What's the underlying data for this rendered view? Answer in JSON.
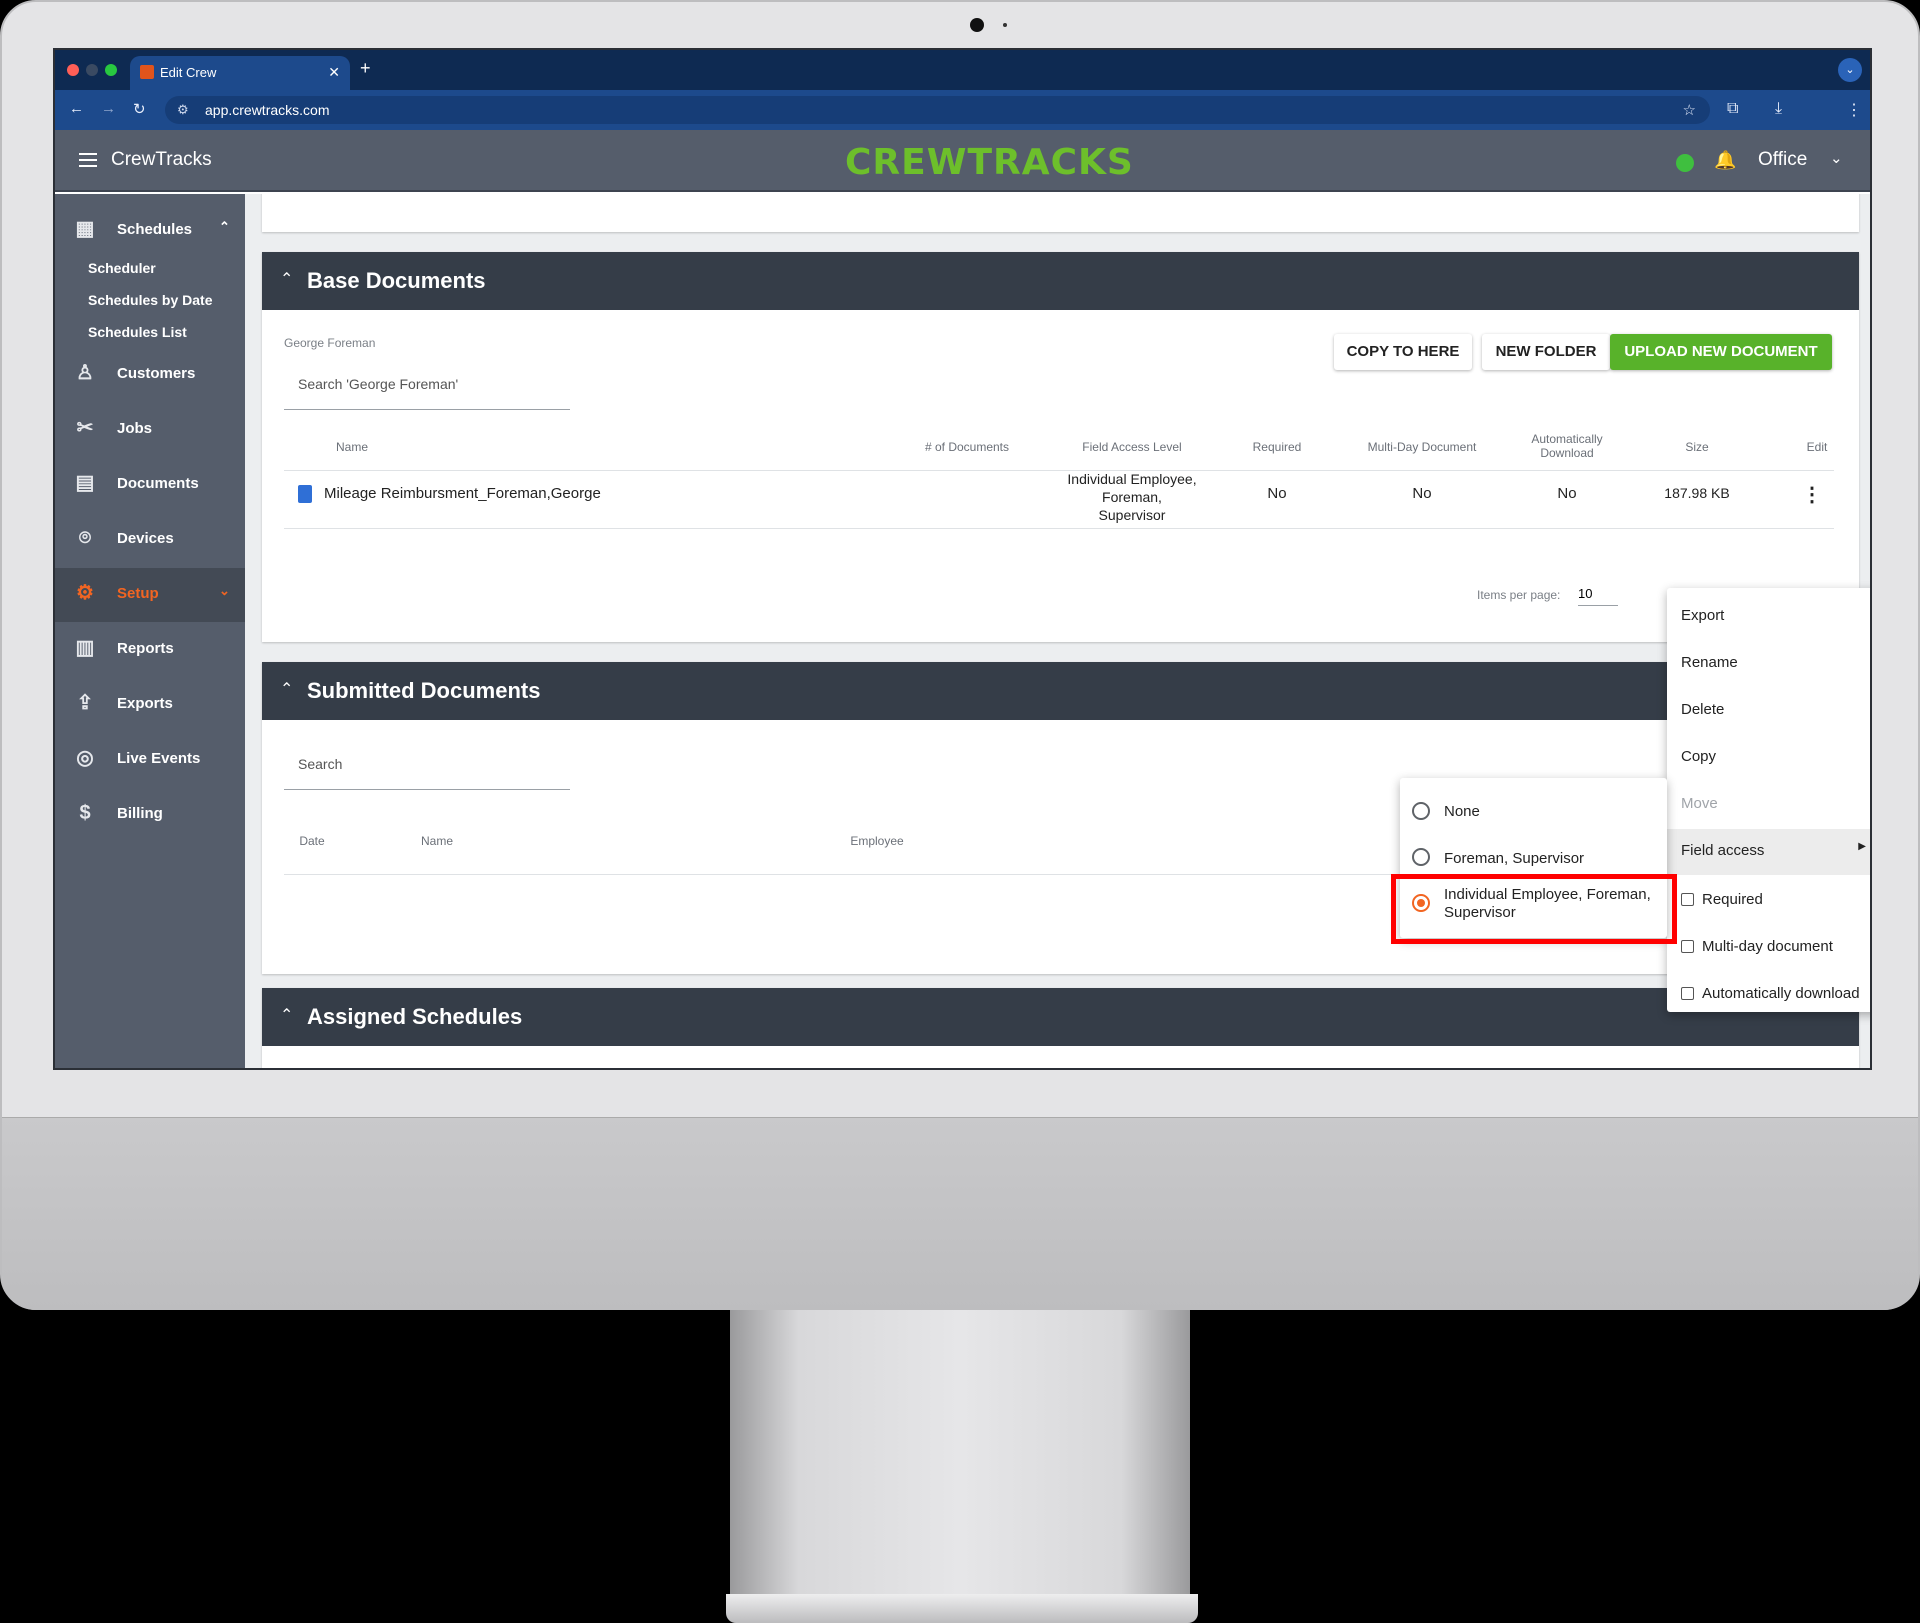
{
  "browser": {
    "tab_title": "Edit Crew",
    "url": "app.crewtracks.com"
  },
  "header": {
    "app_name": "CrewTracks",
    "logo_text": "CREWTRACKS",
    "user_label": "Office",
    "status_color": "#3fbf3f"
  },
  "sidebar": {
    "items": [
      {
        "label": "Schedules",
        "icon": "calendar-icon"
      },
      {
        "label": "Customers",
        "icon": "customer-icon"
      },
      {
        "label": "Jobs",
        "icon": "tools-icon"
      },
      {
        "label": "Documents",
        "icon": "documents-icon"
      },
      {
        "label": "Devices",
        "icon": "location-pin-icon"
      },
      {
        "label": "Setup",
        "icon": "gear-icon"
      },
      {
        "label": "Reports",
        "icon": "bar-chart-icon"
      },
      {
        "label": "Exports",
        "icon": "upload-icon"
      },
      {
        "label": "Live Events",
        "icon": "radar-icon"
      },
      {
        "label": "Billing",
        "icon": "billing-icon"
      }
    ],
    "sub_items": [
      "Scheduler",
      "Schedules by Date",
      "Schedules List"
    ],
    "accent_color": "#f26522"
  },
  "base_documents": {
    "title": "Base Documents",
    "folder_label": "George Foreman",
    "search_placeholder": "Search 'George Foreman'",
    "buttons": {
      "copy": "COPY TO HERE",
      "new_folder": "NEW FOLDER",
      "upload": "UPLOAD NEW DOCUMENT"
    },
    "columns": [
      "Name",
      "# of Documents",
      "Field Access Level",
      "Required",
      "Multi-Day Document",
      "Automatically Download",
      "Size",
      "Edit"
    ],
    "rows": [
      {
        "name": "Mileage Reimbursment_Foreman,George",
        "docs": "",
        "field_access": "Individual Employee, Foreman, Supervisor",
        "required": "No",
        "multi_day": "No",
        "auto_download": "No",
        "size": "187.98 KB"
      }
    ],
    "items_per_page_label": "Items per page:",
    "items_per_page": "10"
  },
  "submitted_documents": {
    "title": "Submitted Documents",
    "search_placeholder": "Search",
    "columns": [
      "Date",
      "Name",
      "Employee"
    ]
  },
  "assigned_schedules": {
    "title": "Assigned Schedules"
  },
  "context_menu": {
    "items": [
      "Export",
      "Rename",
      "Delete",
      "Copy",
      "Move",
      "Field access"
    ],
    "checkboxes": [
      "Required",
      "Multi-day document",
      "Automatically download"
    ]
  },
  "field_access_menu": {
    "options": [
      "None",
      "Foreman, Supervisor",
      "Individual Employee, Foreman, Supervisor"
    ],
    "selected": "Individual Employee, Foreman, Supervisor"
  }
}
